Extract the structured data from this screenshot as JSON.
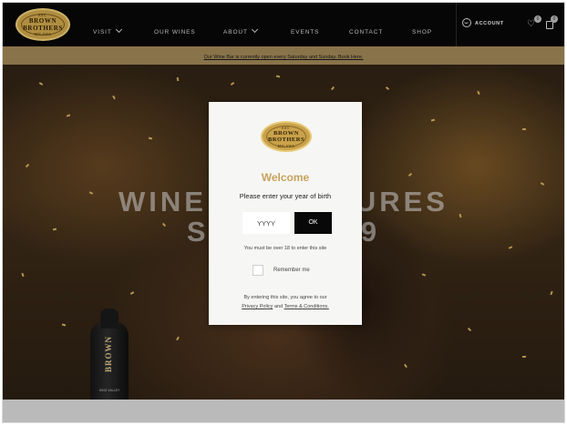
{
  "header": {
    "logo": {
      "top": "EST.",
      "line1": "BROWN",
      "line2": "BROTHERS",
      "bottom": "MILAWA"
    },
    "nav": [
      {
        "label": "VISIT",
        "dropdown": true
      },
      {
        "label": "OUR WINES",
        "dropdown": false
      },
      {
        "label": "ABOUT",
        "dropdown": true
      },
      {
        "label": "EVENTS",
        "dropdown": false
      },
      {
        "label": "CONTACT",
        "dropdown": false
      },
      {
        "label": "SHOP",
        "dropdown": false
      }
    ],
    "account_label": "ACCOUNT",
    "wishlist_count": "0",
    "cart_count": "0"
  },
  "announcement": {
    "text": "Our Wine Bar is currently open every Saturday and Sunday. Book Here."
  },
  "hero": {
    "title_line1": "WINE ADVENTURES",
    "title_line2": "SINCE 1889",
    "bottle_label": "BROWN",
    "bottle_sublabel": "KING VALLEY"
  },
  "age_gate": {
    "welcome": "Welcome",
    "prompt": "Please enter your year of birth",
    "year_placeholder": "YYYY",
    "ok_label": "OK",
    "age_note": "You must be over 18 to enter this site",
    "remember_label": "Remember me",
    "agree_prefix": "By entering this site, you agree to our",
    "privacy_link": "Privacy Policy",
    "and_text": "and",
    "terms_link": "Terms & Conditions."
  },
  "colors": {
    "gold": "#c8a35c",
    "announce_bar": "#9d8355",
    "header_bg": "#070707"
  }
}
